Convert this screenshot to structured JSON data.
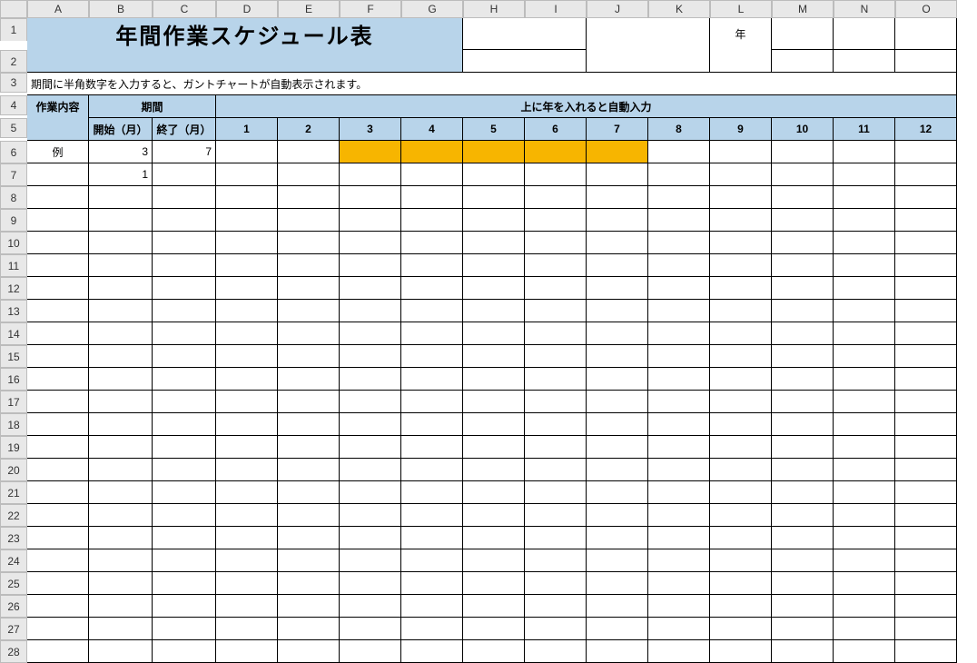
{
  "columns": [
    "A",
    "B",
    "C",
    "D",
    "E",
    "F",
    "G",
    "H",
    "I",
    "J",
    "K",
    "L",
    "M",
    "N",
    "O"
  ],
  "rows": [
    "1",
    "2",
    "3",
    "4",
    "5",
    "6",
    "7",
    "8",
    "9",
    "10",
    "11",
    "12",
    "13",
    "14",
    "15",
    "16",
    "17",
    "18",
    "19",
    "20",
    "21",
    "22",
    "23",
    "24",
    "25",
    "26",
    "27",
    "28"
  ],
  "title": "年間作業スケジュール表",
  "year_label": "年",
  "instruction": "期間に半角数字を入力すると、ガントチャートが自動表示されます。",
  "headers": {
    "task": "作業内容",
    "period": "期間",
    "start": "開始（月）",
    "end": "終了（月）",
    "auto_note": "上に年を入れると自動入力"
  },
  "months": [
    "1",
    "2",
    "3",
    "4",
    "5",
    "6",
    "7",
    "8",
    "9",
    "10",
    "11",
    "12"
  ],
  "sample": {
    "label": "例",
    "start": "3",
    "end": "7"
  },
  "row7_start": "1"
}
